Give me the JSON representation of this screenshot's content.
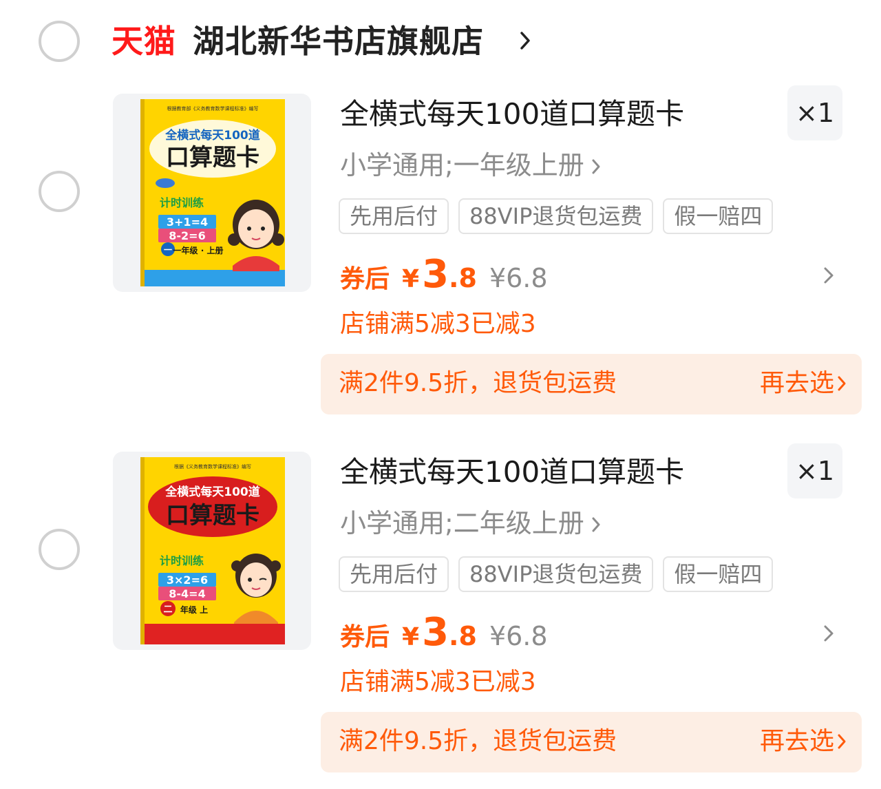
{
  "shop": {
    "platform": "天猫",
    "name": "湖北新华书店旗舰店"
  },
  "items": [
    {
      "title": "全横式每天100道口算题卡",
      "quantity": "×1",
      "variant": "小学通用;一年级上册",
      "tags": [
        "先用后付",
        "88VIP退货包运费",
        "假一赔四"
      ],
      "price_label": "券后",
      "price_yen": "¥",
      "price_int": "3",
      "price_dec": ".8",
      "price_original": "¥6.8",
      "discount": "店铺满5减3已减3",
      "promo": "满2件9.5折，退货包运费",
      "promo_action": "再去选",
      "cover": {
        "top_text": "根据教育部《义务教育数学课程标准》编写",
        "series": "全横式每天100道",
        "main": "口算题卡",
        "training": "计时训练",
        "eq1": "3+1=4",
        "eq2": "8-2=6",
        "grade": "一年级 · 上册",
        "grade_badge": "一",
        "main_color": "#1565c0",
        "bottom_color": "#2ea0e8"
      }
    },
    {
      "title": "全横式每天100道口算题卡",
      "quantity": "×1",
      "variant": "小学通用;二年级上册",
      "tags": [
        "先用后付",
        "88VIP退货包运费",
        "假一赔四"
      ],
      "price_label": "券后",
      "price_yen": "¥",
      "price_int": "3",
      "price_dec": ".8",
      "price_original": "¥6.8",
      "discount": "店铺满5减3已减3",
      "promo": "满2件9.5折，退货包运费",
      "promo_action": "再去选",
      "cover": {
        "top_text": "根据《义务教育数学课程标准》编写",
        "series": "全横式每天100道",
        "main": "口算题卡",
        "training": "计时训练",
        "eq1": "3×2=6",
        "eq2": "8-4=4",
        "grade": "年级 上",
        "grade_badge": "二",
        "main_color": "#d81e1e",
        "bottom_color": "#e02222"
      }
    }
  ],
  "colors": {
    "accent": "#ff5a0a",
    "tmall": "#ff1a1a",
    "promo_bg": "#fdeee4"
  }
}
